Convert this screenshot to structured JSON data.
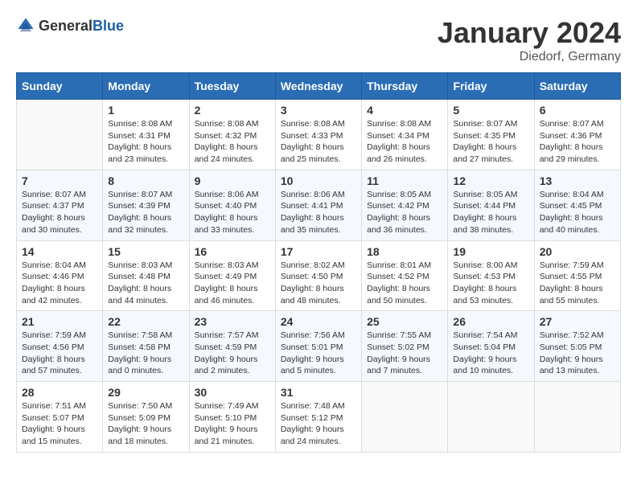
{
  "header": {
    "logo_general": "General",
    "logo_blue": "Blue",
    "month": "January 2024",
    "location": "Diedorf, Germany"
  },
  "days_of_week": [
    "Sunday",
    "Monday",
    "Tuesday",
    "Wednesday",
    "Thursday",
    "Friday",
    "Saturday"
  ],
  "weeks": [
    [
      {
        "day": "",
        "info": ""
      },
      {
        "day": "1",
        "info": "Sunrise: 8:08 AM\nSunset: 4:31 PM\nDaylight: 8 hours\nand 23 minutes."
      },
      {
        "day": "2",
        "info": "Sunrise: 8:08 AM\nSunset: 4:32 PM\nDaylight: 8 hours\nand 24 minutes."
      },
      {
        "day": "3",
        "info": "Sunrise: 8:08 AM\nSunset: 4:33 PM\nDaylight: 8 hours\nand 25 minutes."
      },
      {
        "day": "4",
        "info": "Sunrise: 8:08 AM\nSunset: 4:34 PM\nDaylight: 8 hours\nand 26 minutes."
      },
      {
        "day": "5",
        "info": "Sunrise: 8:07 AM\nSunset: 4:35 PM\nDaylight: 8 hours\nand 27 minutes."
      },
      {
        "day": "6",
        "info": "Sunrise: 8:07 AM\nSunset: 4:36 PM\nDaylight: 8 hours\nand 29 minutes."
      }
    ],
    [
      {
        "day": "7",
        "info": "Sunrise: 8:07 AM\nSunset: 4:37 PM\nDaylight: 8 hours\nand 30 minutes."
      },
      {
        "day": "8",
        "info": "Sunrise: 8:07 AM\nSunset: 4:39 PM\nDaylight: 8 hours\nand 32 minutes."
      },
      {
        "day": "9",
        "info": "Sunrise: 8:06 AM\nSunset: 4:40 PM\nDaylight: 8 hours\nand 33 minutes."
      },
      {
        "day": "10",
        "info": "Sunrise: 8:06 AM\nSunset: 4:41 PM\nDaylight: 8 hours\nand 35 minutes."
      },
      {
        "day": "11",
        "info": "Sunrise: 8:05 AM\nSunset: 4:42 PM\nDaylight: 8 hours\nand 36 minutes."
      },
      {
        "day": "12",
        "info": "Sunrise: 8:05 AM\nSunset: 4:44 PM\nDaylight: 8 hours\nand 38 minutes."
      },
      {
        "day": "13",
        "info": "Sunrise: 8:04 AM\nSunset: 4:45 PM\nDaylight: 8 hours\nand 40 minutes."
      }
    ],
    [
      {
        "day": "14",
        "info": "Sunrise: 8:04 AM\nSunset: 4:46 PM\nDaylight: 8 hours\nand 42 minutes."
      },
      {
        "day": "15",
        "info": "Sunrise: 8:03 AM\nSunset: 4:48 PM\nDaylight: 8 hours\nand 44 minutes."
      },
      {
        "day": "16",
        "info": "Sunrise: 8:03 AM\nSunset: 4:49 PM\nDaylight: 8 hours\nand 46 minutes."
      },
      {
        "day": "17",
        "info": "Sunrise: 8:02 AM\nSunset: 4:50 PM\nDaylight: 8 hours\nand 48 minutes."
      },
      {
        "day": "18",
        "info": "Sunrise: 8:01 AM\nSunset: 4:52 PM\nDaylight: 8 hours\nand 50 minutes."
      },
      {
        "day": "19",
        "info": "Sunrise: 8:00 AM\nSunset: 4:53 PM\nDaylight: 8 hours\nand 53 minutes."
      },
      {
        "day": "20",
        "info": "Sunrise: 7:59 AM\nSunset: 4:55 PM\nDaylight: 8 hours\nand 55 minutes."
      }
    ],
    [
      {
        "day": "21",
        "info": "Sunrise: 7:59 AM\nSunset: 4:56 PM\nDaylight: 8 hours\nand 57 minutes."
      },
      {
        "day": "22",
        "info": "Sunrise: 7:58 AM\nSunset: 4:58 PM\nDaylight: 9 hours\nand 0 minutes."
      },
      {
        "day": "23",
        "info": "Sunrise: 7:57 AM\nSunset: 4:59 PM\nDaylight: 9 hours\nand 2 minutes."
      },
      {
        "day": "24",
        "info": "Sunrise: 7:56 AM\nSunset: 5:01 PM\nDaylight: 9 hours\nand 5 minutes."
      },
      {
        "day": "25",
        "info": "Sunrise: 7:55 AM\nSunset: 5:02 PM\nDaylight: 9 hours\nand 7 minutes."
      },
      {
        "day": "26",
        "info": "Sunrise: 7:54 AM\nSunset: 5:04 PM\nDaylight: 9 hours\nand 10 minutes."
      },
      {
        "day": "27",
        "info": "Sunrise: 7:52 AM\nSunset: 5:05 PM\nDaylight: 9 hours\nand 13 minutes."
      }
    ],
    [
      {
        "day": "28",
        "info": "Sunrise: 7:51 AM\nSunset: 5:07 PM\nDaylight: 9 hours\nand 15 minutes."
      },
      {
        "day": "29",
        "info": "Sunrise: 7:50 AM\nSunset: 5:09 PM\nDaylight: 9 hours\nand 18 minutes."
      },
      {
        "day": "30",
        "info": "Sunrise: 7:49 AM\nSunset: 5:10 PM\nDaylight: 9 hours\nand 21 minutes."
      },
      {
        "day": "31",
        "info": "Sunrise: 7:48 AM\nSunset: 5:12 PM\nDaylight: 9 hours\nand 24 minutes."
      },
      {
        "day": "",
        "info": ""
      },
      {
        "day": "",
        "info": ""
      },
      {
        "day": "",
        "info": ""
      }
    ]
  ]
}
